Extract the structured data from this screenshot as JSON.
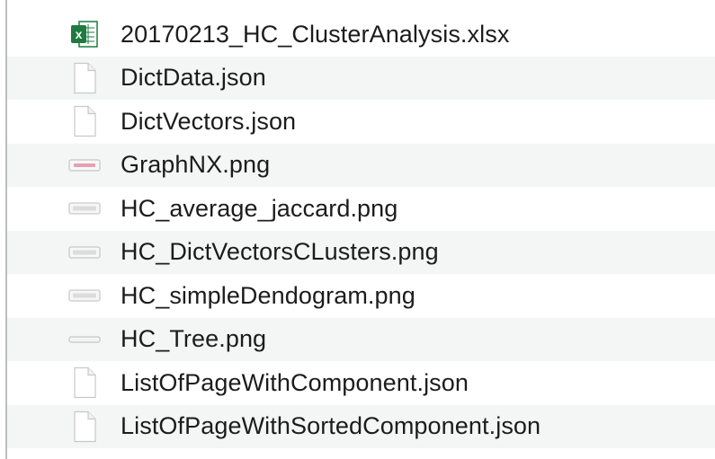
{
  "files": [
    {
      "name": "20170213_HC_ClusterAnalysis.xlsx",
      "icon": "excel-file-icon"
    },
    {
      "name": "DictData.json",
      "icon": "document-file-icon"
    },
    {
      "name": "DictVectors.json",
      "icon": "document-file-icon"
    },
    {
      "name": "GraphNX.png",
      "icon": "image-file-icon"
    },
    {
      "name": "HC_average_jaccard.png",
      "icon": "image-file-icon"
    },
    {
      "name": "HC_DictVectorsCLusters.png",
      "icon": "image-file-icon"
    },
    {
      "name": "HC_simpleDendogram.png",
      "icon": "image-file-icon"
    },
    {
      "name": "HC_Tree.png",
      "icon": "image-file-icon"
    },
    {
      "name": "ListOfPageWithComponent.json",
      "icon": "document-file-icon"
    },
    {
      "name": "ListOfPageWithSortedComponent.json",
      "icon": "document-file-icon"
    }
  ],
  "colors": {
    "excel_green": "#1f7a3f",
    "row_alt": "#f4f5f5",
    "text": "#1c1c1c"
  }
}
